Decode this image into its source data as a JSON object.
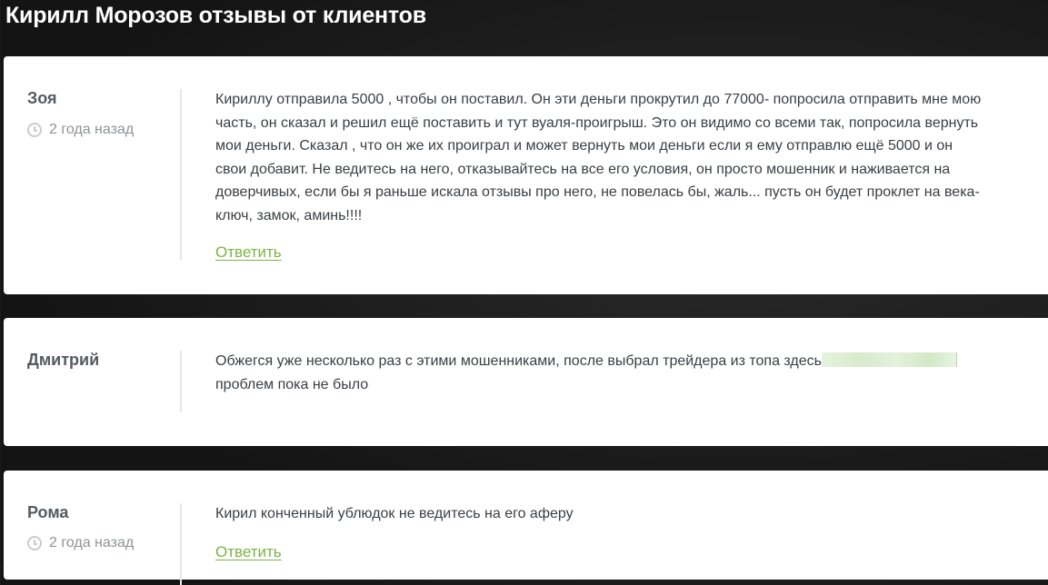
{
  "page": {
    "title": "Кирилл Морозов отзывы от клиентов"
  },
  "reviews": [
    {
      "author": "Зоя",
      "date": "2 года назад",
      "text": "Кириллу отправила 5000 , чтобы он поставил. Он эти деньги прокрутил до 77000- попросила отправить мне мою\nчасть, он сказал и решил ещё поставить и тут вуаля-проигрыш. Это он видимо со всеми так, попросила вернуть\nмои деньги. Сказал , что он же их проиграл и может вернуть мои деньги если я ему отправлю ещё 5000 и он\nсвои добавит. Не ведитесь на него, отказывайтесь на все его условия, он просто мошенник и наживается на\nдоверчивых, если бы я раньше искала отзывы про него, не повелась бы, жаль... пусть он будет проклет на века-\nключ, замок, аминь!!!!",
      "reply_label": "Ответить"
    },
    {
      "author": "Дмитрий",
      "text_part1": "Обжегся уже несколько раз с этими мошенниками, после выбрал трейдера из топа здесь",
      "text_part2": "проблем пока не было"
    },
    {
      "author": "Рома",
      "date": "2 года назад",
      "text": "Кирил конченный ублюдок не ведитесь на его аферу",
      "reply_label": "Ответить"
    }
  ],
  "icons": {
    "date": "clock-icon"
  },
  "colors": {
    "accent": "#7cb342",
    "author": "#555a5f",
    "text": "#3b3f43",
    "muted": "#8f9396"
  }
}
